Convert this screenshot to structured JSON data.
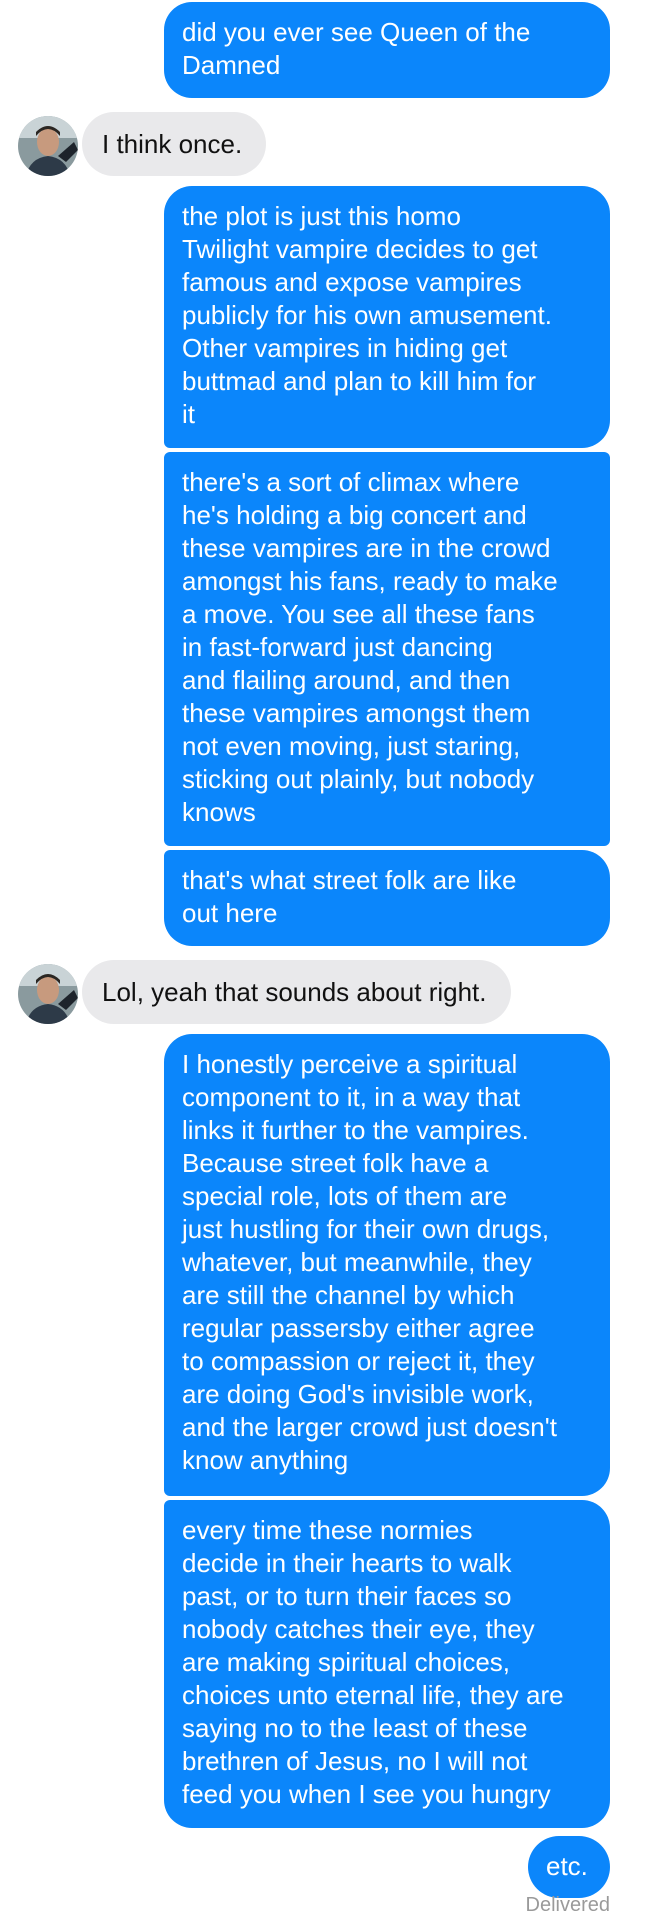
{
  "conversation": {
    "messages": [
      {
        "sender": "me",
        "text": "did you ever see Queen of the\nDamned"
      },
      {
        "sender": "them",
        "text": "I think once."
      },
      {
        "sender": "me",
        "text": "the plot is just this homo\nTwilight vampire decides to get\nfamous and expose vampires\npublicly for his own amusement.\nOther vampires in hiding get\nbuttmad and plan to kill him for\nit"
      },
      {
        "sender": "me",
        "text": "there's a sort of climax where\nhe's holding a big concert and\nthese vampires are in the crowd\namongst his fans, ready to make\na move. You see all these fans\nin fast-forward just dancing\nand flailing around, and then\nthese vampires amongst them\nnot even moving, just staring,\nsticking out plainly, but nobody\nknows"
      },
      {
        "sender": "me",
        "text": "that's what street folk are like\nout here"
      },
      {
        "sender": "them",
        "text": "Lol, yeah that sounds about right."
      },
      {
        "sender": "me",
        "text": "I honestly perceive a spiritual\ncomponent to it, in a way that\nlinks it further to the vampires.\nBecause street folk have a\nspecial role, lots of them are\njust hustling for their own drugs,\nwhatever, but meanwhile, they\nare still the channel by which\nregular passersby either agree\nto compassion or reject it, they\nare doing God's invisible work,\nand the larger crowd just doesn't\nknow anything"
      },
      {
        "sender": "me",
        "text": "every time these normies\ndecide in their hearts to walk\npast, or to turn their faces so\nnobody catches their eye, they\nare making spiritual choices,\nchoices unto eternal life, they are\nsaying no to the least of these\nbrethren of Jesus, no I will not\nfeed you when I see you hungry"
      },
      {
        "sender": "me",
        "text": "etc."
      }
    ],
    "status": "Delivered"
  },
  "colors": {
    "outgoing_bubble": "#0b86fb",
    "incoming_bubble": "#e9e9eb",
    "status_text": "#9a9a9a"
  }
}
